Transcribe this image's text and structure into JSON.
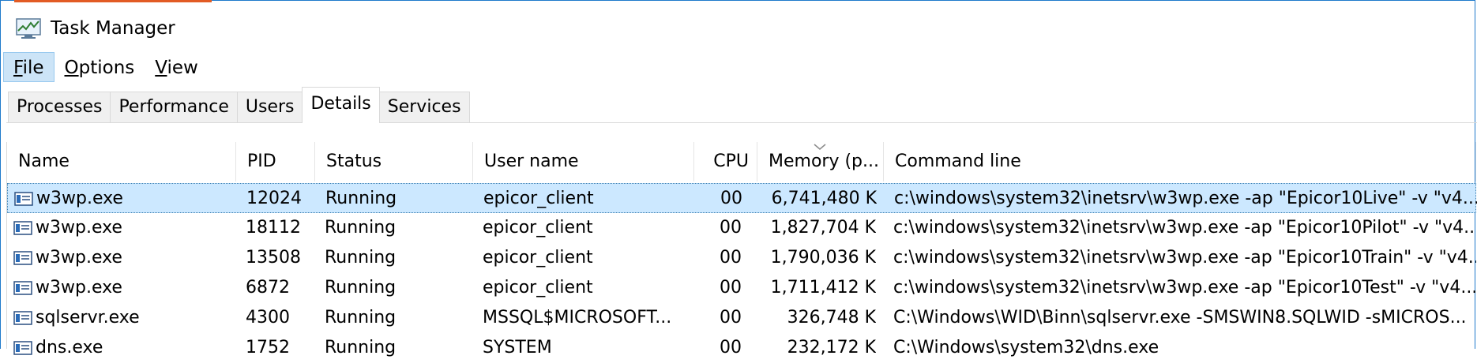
{
  "window": {
    "title": "Task Manager",
    "icon": "task-manager-icon",
    "border_color": "#1f7acb"
  },
  "menu": {
    "items": [
      {
        "label": "File",
        "mnemonic": "F",
        "rest": "ile",
        "active": true
      },
      {
        "label": "Options",
        "mnemonic": "O",
        "rest": "ptions",
        "active": false
      },
      {
        "label": "View",
        "mnemonic": "V",
        "rest": "iew",
        "active": false
      }
    ]
  },
  "tabs": [
    {
      "label": "Processes",
      "selected": false
    },
    {
      "label": "Performance",
      "selected": false
    },
    {
      "label": "Users",
      "selected": false
    },
    {
      "label": "Details",
      "selected": true
    },
    {
      "label": "Services",
      "selected": false
    }
  ],
  "table": {
    "sorted_column": "Memory (p...",
    "columns": [
      "Name",
      "PID",
      "Status",
      "User name",
      "CPU",
      "Memory (p...",
      "Command line"
    ],
    "rows": [
      {
        "name": "w3wp.exe",
        "pid": "12024",
        "status": "Running",
        "user": "epicor_client",
        "cpu": "00",
        "memory": "6,741,480 K",
        "cmd": "c:\\windows\\system32\\inetsrv\\w3wp.exe -ap \"Epicor10Live\" -v \"v4....",
        "selected": true
      },
      {
        "name": "w3wp.exe",
        "pid": "18112",
        "status": "Running",
        "user": "epicor_client",
        "cpu": "00",
        "memory": "1,827,704 K",
        "cmd": "c:\\windows\\system32\\inetsrv\\w3wp.exe -ap \"Epicor10Pilot\" -v \"v4....",
        "selected": false
      },
      {
        "name": "w3wp.exe",
        "pid": "13508",
        "status": "Running",
        "user": "epicor_client",
        "cpu": "00",
        "memory": "1,790,036 K",
        "cmd": "c:\\windows\\system32\\inetsrv\\w3wp.exe -ap \"Epicor10Train\" -v \"v4....",
        "selected": false
      },
      {
        "name": "w3wp.exe",
        "pid": "6872",
        "status": "Running",
        "user": "epicor_client",
        "cpu": "00",
        "memory": "1,711,412 K",
        "cmd": "c:\\windows\\system32\\inetsrv\\w3wp.exe -ap \"Epicor10Test\" -v \"v4....",
        "selected": false
      },
      {
        "name": "sqlservr.exe",
        "pid": "4300",
        "status": "Running",
        "user": "MSSQL$MICROSOFT...",
        "cpu": "00",
        "memory": "326,748 K",
        "cmd": "C:\\Windows\\WID\\Binn\\sqlservr.exe -SMSWIN8.SQLWID -sMICROS...",
        "selected": false
      },
      {
        "name": "dns.exe",
        "pid": "1752",
        "status": "Running",
        "user": "SYSTEM",
        "cpu": "00",
        "memory": "232,172 K",
        "cmd": "C:\\Windows\\system32\\dns.exe",
        "selected": false
      }
    ]
  },
  "colors": {
    "selection_bg": "#cce8ff",
    "menu_active_bg": "#cce4f7",
    "accent": "#e25b24"
  }
}
